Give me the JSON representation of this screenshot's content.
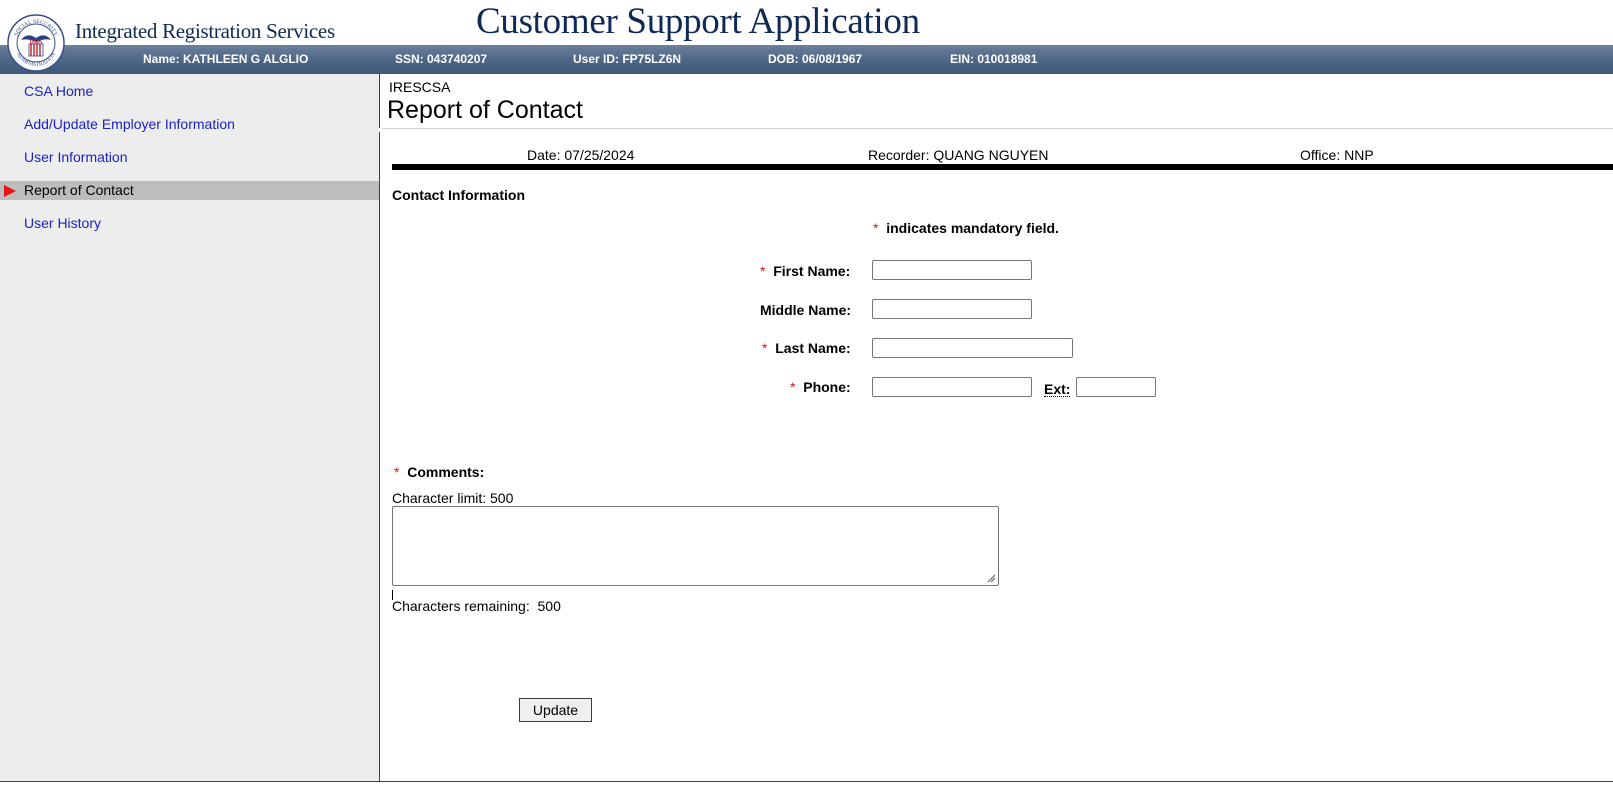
{
  "header": {
    "system_name": "Integrated Registration Services",
    "app_title": "Customer Support Application",
    "seal_text_top": "SOCIAL SECURITY",
    "seal_text_center": "USA",
    "seal_text_bottom": "ADMINISTRATION"
  },
  "userbar": {
    "name": "Name: KATHLEEN G ALGLIO",
    "ssn": "SSN: 043740207",
    "user_id": "User ID: FP75LZ6N",
    "dob": "DOB: 06/08/1967",
    "ein": "EIN: 010018981"
  },
  "sidebar": {
    "items": [
      {
        "label": "CSA Home",
        "active": false
      },
      {
        "label": "Add/Update Employer Information",
        "active": false
      },
      {
        "label": "User Information",
        "active": false
      },
      {
        "label": "Report of Contact",
        "active": true
      },
      {
        "label": "User History",
        "active": false
      }
    ]
  },
  "main": {
    "breadcrumb": "IRESCSA",
    "page_title": "Report of Contact",
    "date": "Date: 07/25/2024",
    "recorder": "Recorder: QUANG NGUYEN",
    "office": "Office: NNP",
    "section_title": "Contact Information",
    "mandatory_note": "indicates mandatory field.",
    "required_marker": "*"
  },
  "form": {
    "first_name_label": "First Name:",
    "first_name_value": "",
    "middle_name_label": "Middle Name:",
    "middle_name_value": "",
    "last_name_label": "Last Name:",
    "last_name_value": "",
    "phone_label": "Phone:",
    "phone_value": "",
    "ext_label": "Ext:",
    "ext_value": "",
    "comments_label": "Comments:",
    "char_limit": "Character limit: 500",
    "comments_value": "",
    "chars_remaining_label": "Characters remaining:",
    "chars_remaining_value": "500",
    "update_button": "Update"
  },
  "colors": {
    "userbar": "#526a89",
    "nav_link": "#1a22c8",
    "active_nav_bg": "#bdbdbd",
    "active_arrow": "#ee1111",
    "required": "#d21818",
    "title": "#102a55"
  }
}
